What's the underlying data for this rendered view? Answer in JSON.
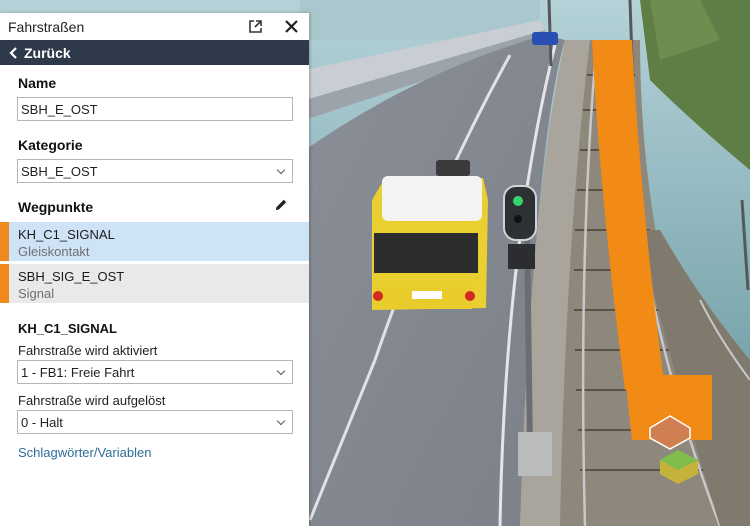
{
  "panel": {
    "title": "Fahrstraßen",
    "back_label": "Zurück",
    "name_label": "Name",
    "name_value": "SBH_E_OST",
    "category_label": "Kategorie",
    "category_value": "SBH_E_OST",
    "waypoints_label": "Wegpunkte",
    "waypoints": [
      {
        "name": "KH_C1_SIGNAL",
        "type": "Gleiskontakt",
        "selected": true
      },
      {
        "name": "SBH_SIG_E_OST",
        "type": "Signal",
        "selected": false
      }
    ],
    "detail_title": "KH_C1_SIGNAL",
    "activated_label": "Fahrstraße wird aktiviert",
    "activated_value": "1 - FB1: Freie Fahrt",
    "released_label": "Fahrstraße wird aufgelöst",
    "released_value": "0 - Halt",
    "tags_link": "Schlagwörter/Variablen"
  },
  "colors": {
    "header_bg": "#2e3a49",
    "accent_orange": "#f0891c",
    "selected_row": "#cfe3f7",
    "unselected_row": "#e9e9e9",
    "link": "#2f6e97"
  }
}
